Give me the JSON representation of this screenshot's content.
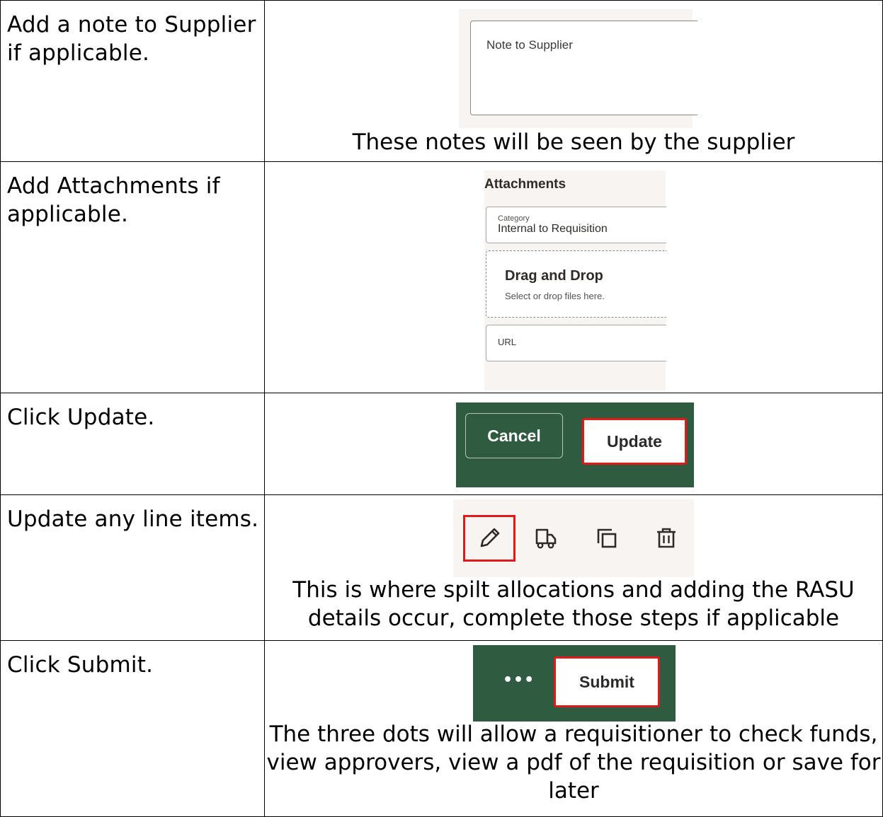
{
  "rows": [
    {
      "step": "Add a note to Supplier if applicable.",
      "shot": {
        "field_label": "Note to Supplier"
      },
      "caption": "These notes will be seen by the supplier"
    },
    {
      "step": "Add Attachments if applicable.",
      "shot": {
        "title": "Attachments",
        "category_label": "Category",
        "category_value": "Internal to Requisition",
        "drop_title": "Drag and Drop",
        "drop_subtitle": "Select or drop files here.",
        "url_label": "URL"
      }
    },
    {
      "step": "Click Update.",
      "shot": {
        "cancel_label": "Cancel",
        "update_label": "Update"
      }
    },
    {
      "step": "Update any line items.",
      "shot": {
        "icons": [
          "pencil-edit-icon",
          "truck-icon",
          "duplicate-icon",
          "trash-icon"
        ]
      },
      "caption": "This is where spilt allocations and adding the RASU details occur, complete those steps if applicable"
    },
    {
      "step": "Click Submit.",
      "shot": {
        "more_label": "•••",
        "submit_label": "Submit"
      },
      "caption": "The three dots will allow a requisitioner to check funds, view approvers, view a pdf of the requisition or save for later"
    }
  ],
  "colors": {
    "brand_green": "#2f5c40",
    "highlight_red": "#e01919",
    "panel_bg": "#f7f4f1"
  }
}
